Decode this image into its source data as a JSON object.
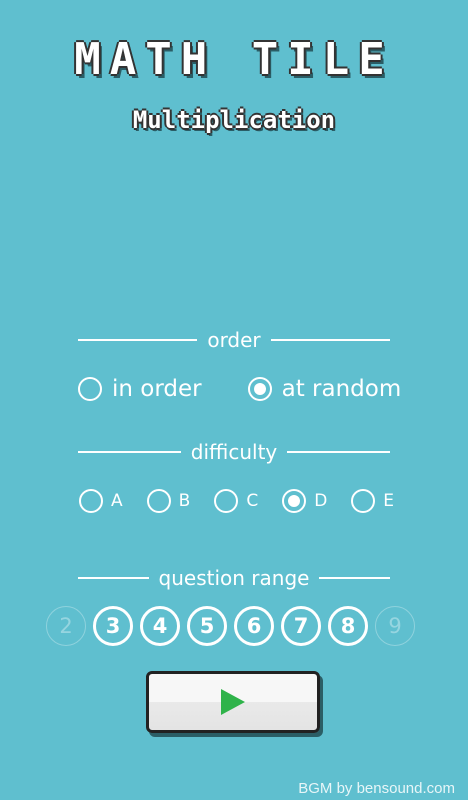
{
  "title": "MATH TILE",
  "subtitle": "Multiplication",
  "order": {
    "header": "order",
    "options": [
      {
        "label": "in order",
        "selected": false
      },
      {
        "label": "at random",
        "selected": true
      }
    ]
  },
  "difficulty": {
    "header": "difficulty",
    "options": [
      {
        "label": "A",
        "selected": false
      },
      {
        "label": "B",
        "selected": false
      },
      {
        "label": "C",
        "selected": false
      },
      {
        "label": "D",
        "selected": true
      },
      {
        "label": "E",
        "selected": false
      }
    ]
  },
  "range": {
    "header": "question range",
    "numbers": [
      {
        "label": "2",
        "enabled": false
      },
      {
        "label": "3",
        "enabled": true
      },
      {
        "label": "4",
        "enabled": true
      },
      {
        "label": "5",
        "enabled": true
      },
      {
        "label": "6",
        "enabled": true
      },
      {
        "label": "7",
        "enabled": true
      },
      {
        "label": "8",
        "enabled": true
      },
      {
        "label": "9",
        "enabled": false
      }
    ]
  },
  "play_icon": "play-icon",
  "credit": "BGM by bensound.com",
  "colors": {
    "background": "#5fbfcf",
    "play_icon": "#2fb34a",
    "text": "#ffffff"
  }
}
